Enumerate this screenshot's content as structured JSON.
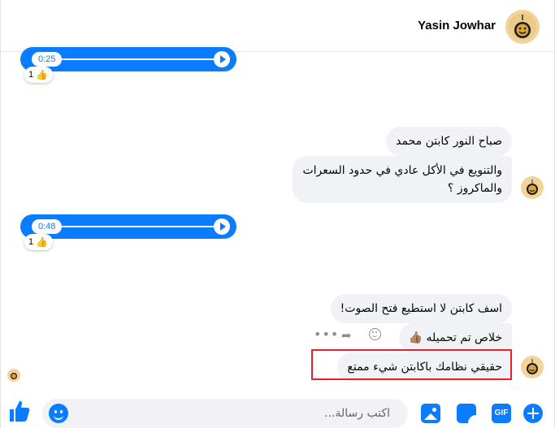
{
  "header": {
    "contact_name": "Yasin Jowhar",
    "avatar_icon": "profile-avatar"
  },
  "messages": [
    {
      "kind": "audio",
      "duration": "0:25",
      "reaction_count": "1",
      "reaction_icon": "thumbs-up-icon"
    },
    {
      "kind": "text",
      "text": "صباح النور كابتن محمد"
    },
    {
      "kind": "text",
      "lines": [
        "والتنويع في الأكل عادي في حدود السعرات",
        "والماكروز ؟"
      ]
    },
    {
      "kind": "audio",
      "duration": "0:48",
      "reaction_count": "1",
      "reaction_icon": "thumbs-up-icon"
    },
    {
      "kind": "text",
      "text": "اسف كابتن لا استطيع فتح الصوت!"
    },
    {
      "kind": "text",
      "text": "خلاص تم تحميله",
      "emoji": "👍🏽"
    },
    {
      "kind": "text",
      "text": "حقيقي نظامك باكابتن شيء ممتع",
      "highlighted": true
    }
  ],
  "message_actions": [
    "more-icon",
    "reply-icon",
    "react-icon"
  ],
  "composer": {
    "placeholder": "اكتب رسالة...",
    "value": "",
    "buttons": [
      "add-icon",
      "gif-icon",
      "sticker-icon",
      "photo-icon",
      "emoji-icon",
      "like-icon"
    ],
    "gif_label": "GIF"
  },
  "colors": {
    "accent": "#0a7cff",
    "bubble": "#f0f2f5",
    "highlight_border": "#e3202c",
    "text": "#050505"
  }
}
